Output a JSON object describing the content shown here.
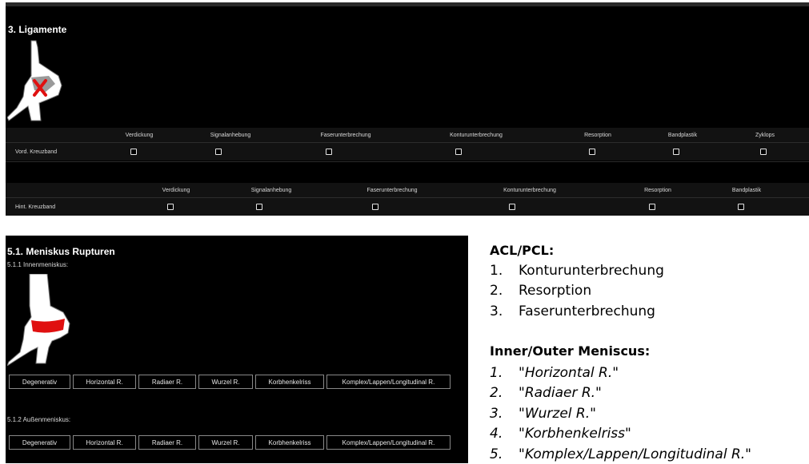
{
  "ligaments": {
    "title": "3. Ligamente",
    "rows": [
      {
        "label": "Vord. Kreuzband",
        "columns": [
          "Verdickung",
          "Signalanhebung",
          "Faserunterbrechung",
          "Konturunterbrechung",
          "Resorption",
          "Bandplastik",
          "Zyklops"
        ]
      },
      {
        "label": "Hint. Kreuzband",
        "columns": [
          "Verdickung",
          "Signalanhebung",
          "Faserunterbrechung",
          "Konturunterbrechung",
          "Resorption",
          "Bandplastik"
        ]
      }
    ]
  },
  "meniscus": {
    "title": "5.1. Meniskus Rupturen",
    "inner_label": "5.1.1 Innenmeniskus:",
    "outer_label": "5.1.2 Außenmeniskus:",
    "buttons": [
      "Degenerativ",
      "Horizontal R.",
      "Radiaer R.",
      "Wurzel R.",
      "Korbhenkelriss",
      "Komplex/Lappen/Longitudinal R."
    ]
  },
  "notes": {
    "acl_title": "ACL/PCL:",
    "acl_items": [
      {
        "num": "1.",
        "text": "Konturunterbrechung"
      },
      {
        "num": "2.",
        "text": "Resorption"
      },
      {
        "num": "3.",
        "text": "Faserunterbrechung"
      }
    ],
    "men_title": "Inner/Outer Meniscus:",
    "men_items": [
      {
        "num": "1.",
        "text": "\"Horizontal R.\""
      },
      {
        "num": "2.",
        "text": "\"Radiaer R.\""
      },
      {
        "num": "3.",
        "text": "\"Wurzel R.\""
      },
      {
        "num": "4.",
        "text": "\"Korbhenkelriss\""
      },
      {
        "num": "5.",
        "text": "\"Komplex/Lappen/Longitudinal R.\""
      }
    ]
  },
  "colors": {
    "panel_bg": "#000000",
    "marker_red": "#e01010"
  }
}
